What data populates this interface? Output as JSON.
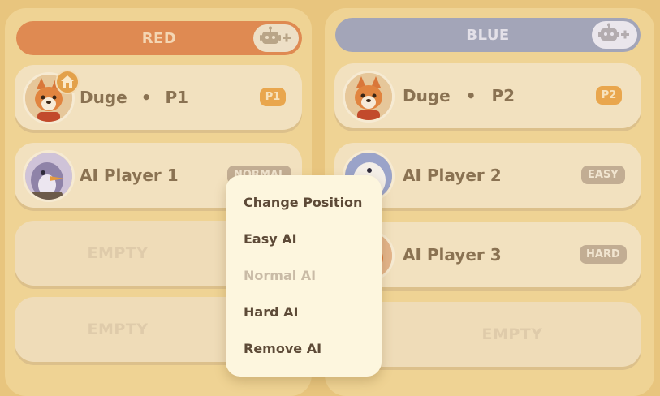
{
  "red_team": {
    "title": "RED",
    "color": "#df8a52",
    "add_ai_icon": "add-robot-icon",
    "slots": [
      {
        "name": "Duge",
        "separator": "•",
        "player": "P1",
        "badge": "P1",
        "avatar": "corgi-avatar",
        "is_host": true,
        "host_icon": "home-icon"
      },
      {
        "name": "AI Player 1",
        "badge": "NORMAL",
        "avatar": "penguin-avatar"
      },
      {
        "empty_label": "EMPTY"
      },
      {
        "empty_label": "EMPTY"
      }
    ]
  },
  "blue_team": {
    "title": "BLUE",
    "color": "#a3a5b8",
    "add_ai_icon": "add-robot-icon",
    "slots": [
      {
        "name": "Duge",
        "separator": "•",
        "player": "P2",
        "badge": "P2",
        "avatar": "corgi-avatar"
      },
      {
        "name": "AI Player 2",
        "badge": "EASY",
        "avatar": "duck-avatar"
      },
      {
        "name": "AI Player 3",
        "badge": "HARD",
        "avatar": "fox-avatar"
      },
      {
        "empty_label": "EMPTY"
      }
    ]
  },
  "context_menu": {
    "items": [
      {
        "label": "Change Position",
        "enabled": true
      },
      {
        "label": "Easy AI",
        "enabled": true
      },
      {
        "label": "Normal AI",
        "enabled": false
      },
      {
        "label": "Hard AI",
        "enabled": true
      },
      {
        "label": "Remove AI",
        "enabled": true
      }
    ]
  }
}
